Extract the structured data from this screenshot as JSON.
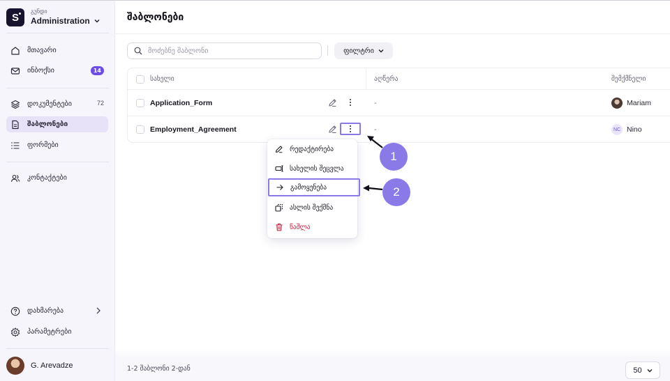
{
  "sidebar": {
    "org_sub": "გუნდი",
    "org_name": "Administration",
    "logo_letter": "S",
    "nav": {
      "home": "მთავარი",
      "inbox": "ინბოქსი",
      "inbox_badge": "14",
      "documents": "დოკუმენტები",
      "documents_count": "72",
      "templates": "შაბლონები",
      "forms": "ფორმები",
      "contacts": "კონტაქტები",
      "help": "დახმარება",
      "settings": "პარამეტრები"
    },
    "user_name": "G. Arevadze",
    "icons": [
      "home-icon",
      "inbox-icon",
      "layers-icon",
      "document-icon",
      "list-icon",
      "users-icon",
      "help-icon",
      "gear-icon"
    ]
  },
  "main": {
    "title": "შაბლონები",
    "search_placeholder": "მოძებნე შაბლონი",
    "filter_label": "ფილტრი",
    "table": {
      "headers": {
        "name": "სახელი",
        "description": "აღწერა",
        "creator": "შემქმნელი"
      },
      "rows": [
        {
          "name": "Application_Form",
          "description": "-",
          "creator": "Mariam"
        },
        {
          "name": "Employment_Agreement",
          "description": "-",
          "creator": "Nino",
          "creator_initials": "NC"
        }
      ]
    },
    "menu": {
      "edit": "რედაქტირება",
      "rename": "სახელის შეცვლა",
      "use": "გამოყენება",
      "duplicate": "ასლის შექმნა",
      "delete": "წაშლა"
    },
    "callouts": {
      "one": "1",
      "two": "2"
    },
    "footer": {
      "range_text": "1-2 შაბლონი 2-დან",
      "page_size": "50"
    },
    "colors": {
      "accent": "#6d4ce8",
      "highlight": "#8a7ae8",
      "danger": "#c81e3c"
    }
  }
}
